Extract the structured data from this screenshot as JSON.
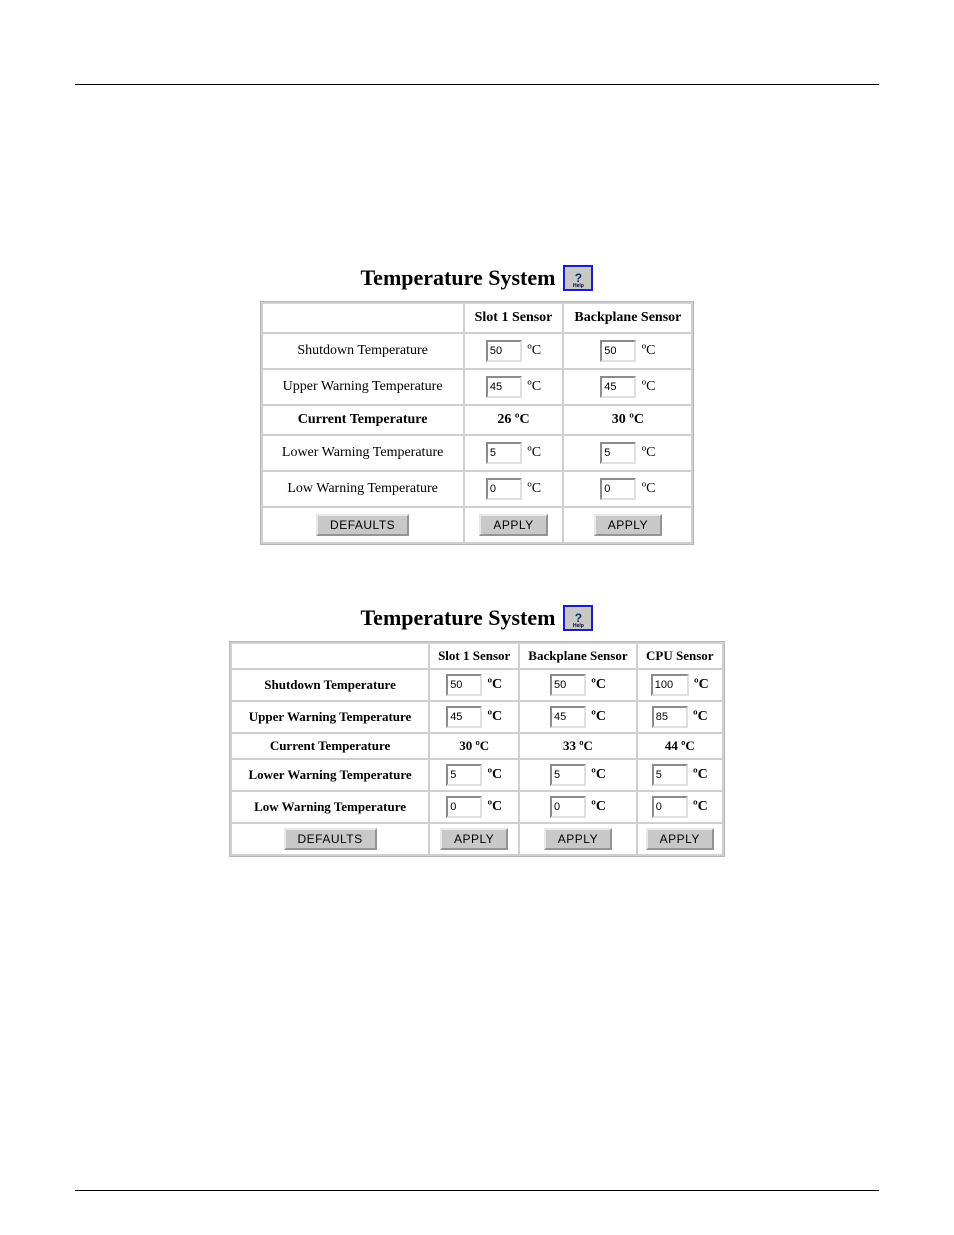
{
  "header": {
    "left": "",
    "right": ""
  },
  "section1": {
    "heading": "",
    "sub": "",
    "caption": ""
  },
  "panel1": {
    "title": "Temperature System",
    "columns": [
      "Slot 1 Sensor",
      "Backplane Sensor"
    ],
    "rows": {
      "shutdown": {
        "label": "Shutdown Temperature",
        "values": [
          "50",
          "50"
        ]
      },
      "upperWarn": {
        "label": "Upper Warning Temperature",
        "values": [
          "45",
          "45"
        ]
      },
      "current": {
        "label": "Current Temperature",
        "values": [
          "26 ºC",
          "30 ºC"
        ]
      },
      "lowerWarn": {
        "label": "Lower Warning Temperature",
        "values": [
          "5",
          "5"
        ]
      },
      "lowWarn": {
        "label": "Low Warning Temperature",
        "values": [
          "0",
          "0"
        ]
      }
    },
    "buttons": {
      "defaults": "DEFAULTS",
      "apply": "APPLY"
    },
    "unit": "ºC"
  },
  "section2": {
    "caption": ""
  },
  "panel2": {
    "title": "Temperature System",
    "columns": [
      "Slot 1 Sensor",
      "Backplane Sensor",
      "CPU Sensor"
    ],
    "rows": {
      "shutdown": {
        "label": "Shutdown Temperature",
        "values": [
          "50",
          "50",
          "100"
        ]
      },
      "upperWarn": {
        "label": "Upper Warning Temperature",
        "values": [
          "45",
          "45",
          "85"
        ]
      },
      "current": {
        "label": "Current Temperature",
        "values": [
          "30 ºC",
          "33 ºC",
          "44 ºC"
        ]
      },
      "lowerWarn": {
        "label": "Lower Warning Temperature",
        "values": [
          "5",
          "5",
          "5"
        ]
      },
      "lowWarn": {
        "label": "Low Warning Temperature",
        "values": [
          "0",
          "0",
          "0"
        ]
      }
    },
    "buttons": {
      "defaults": "DEFAULTS",
      "apply": "APPLY"
    },
    "unit": "ºC"
  },
  "footer": {
    "left": "",
    "right": ""
  },
  "icons": {
    "help": "?"
  }
}
